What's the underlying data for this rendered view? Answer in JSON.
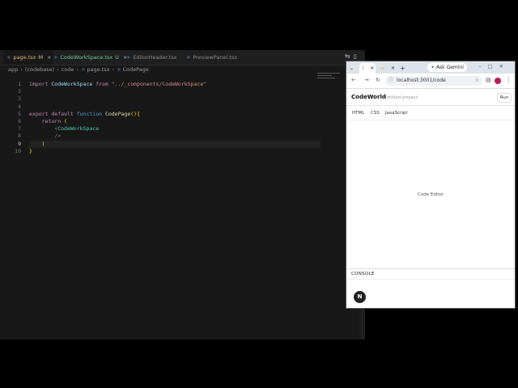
{
  "editor": {
    "tabs": [
      {
        "label": "page.tsx",
        "status": "M",
        "close": "×"
      },
      {
        "label": "CodeWorkSpace.tsx",
        "status": "U",
        "close": "×"
      },
      {
        "label": "EditorHeader.tsx"
      },
      {
        "label": "PreviewPanel.tsx"
      }
    ],
    "breadcrumb": [
      "app",
      "(codebase)",
      "code",
      "page.tsx",
      "CodePage"
    ],
    "line_numbers": [
      "1",
      "2",
      "3",
      "4",
      "5",
      "6",
      "7",
      "8",
      "9",
      "10"
    ],
    "code": {
      "l1_kw": "import",
      "l1_name": " CodeWorkSpace ",
      "l1_from": "from",
      "l1_str": " \"../_components/CodeWorkSpace\"",
      "l5_export": "export",
      "l5_default": " default ",
      "l5_function": "function",
      "l5_name": " CodePage",
      "l5_paren": "(){",
      "l6_return": "    return",
      "l6_paren": " (",
      "l7_open": "        <",
      "l7_tag": "CodeWorkSpace",
      "l8_close": "        />",
      "l9_paren": "    )",
      "l10_brace": "}"
    }
  },
  "browser": {
    "ask_label": "Ask Gemini",
    "url": "localhost:3001/code",
    "app_title": "CodeWorld",
    "project_name": "untitled project",
    "run_label": "Run",
    "lang_tabs": [
      "HTML",
      "CSS",
      "JavaScript"
    ],
    "editor_placeholder": "Code Editor",
    "console_label": "CONSOLE",
    "next_badge": "N"
  },
  "colors": {
    "editor_bg": "#181818",
    "modified": "#d7ba7d",
    "untracked": "#73c991",
    "avatar": "#c2185b"
  }
}
